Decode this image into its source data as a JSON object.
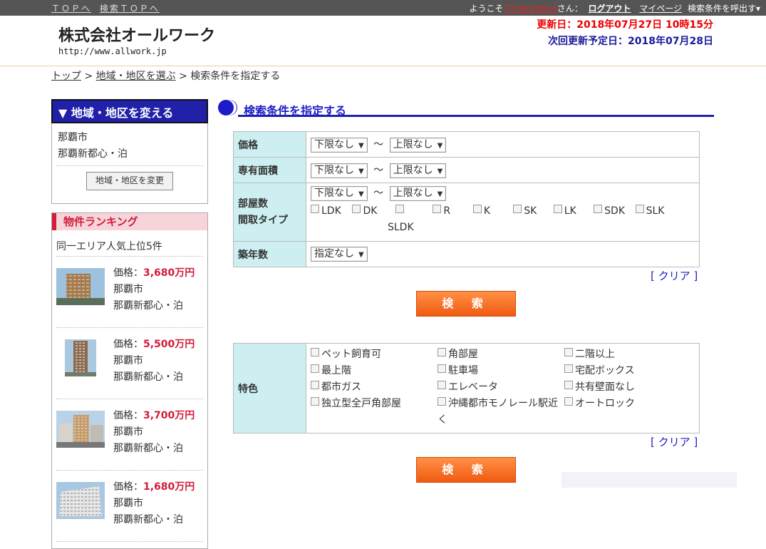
{
  "topbar": {
    "links": [
      "ＴＯＰへ",
      "検索ＴＯＰへ"
    ],
    "welcome_prefix": "ようこそ",
    "username": "77n9c2n6n4",
    "welcome_suffix": "さん：",
    "logout": "ログアウト",
    "mypage": "マイページ",
    "saved_search": "検索条件を呼出す▾"
  },
  "header": {
    "company": "株式会社オールワーク",
    "url": "http://www.allwork.jp",
    "updated": "更新日：2018年07月27日 10時15分",
    "next_update": "次回更新予定日：2018年07月28日"
  },
  "breadcrumb": {
    "items": [
      "トップ",
      "地域・地区を選ぶ"
    ],
    "separator": ">",
    "current": "検索条件を指定する"
  },
  "sidebar": {
    "area": {
      "title": "▼ 地域・地区を変える",
      "city": "那覇市",
      "district": "那覇新都心・泊",
      "change_button": "地域・地区を変更"
    },
    "ranking": {
      "title": "物件ランキング",
      "subtitle": "同一エリア人気上位5件",
      "price_label": "価格：",
      "items": [
        {
          "price": "3,680万円",
          "city": "那覇市",
          "district": "那覇新都心・泊"
        },
        {
          "price": "5,500万円",
          "city": "那覇市",
          "district": "那覇新都心・泊"
        },
        {
          "price": "3,700万円",
          "city": "那覇市",
          "district": "那覇新都心・泊"
        },
        {
          "price": "1,680万円",
          "city": "那覇市",
          "district": "那覇新都心・泊"
        }
      ]
    }
  },
  "main": {
    "section_title": "検索条件を指定する",
    "conditions": {
      "price": {
        "label": "価格",
        "min": "下限なし",
        "max": "上限なし"
      },
      "area": {
        "label": "専有面積",
        "min": "下限なし",
        "max": "上限なし"
      },
      "rooms": {
        "label1": "部屋数",
        "label2": "間取タイプ",
        "min": "下限なし",
        "max": "上限なし",
        "types": [
          "LDK",
          "DK",
          "",
          "R",
          "K",
          "SK",
          "LK",
          "SDK",
          "SLK"
        ],
        "extra_type": "SLDK"
      },
      "age": {
        "label": "築年数",
        "value": "指定なし"
      },
      "tilde": "～"
    },
    "clear_label": "[ クリア ]",
    "search_label": "検 索",
    "features": {
      "label": "特色",
      "items": [
        "ペット飼育可",
        "角部屋",
        "二階以上",
        "最上階",
        "駐車場",
        "宅配ボックス",
        "都市ガス",
        "エレベータ",
        "共有壁面なし",
        "独立型全戸角部屋",
        "沖縄都市モノレール駅近く",
        "オートロック"
      ]
    }
  }
}
